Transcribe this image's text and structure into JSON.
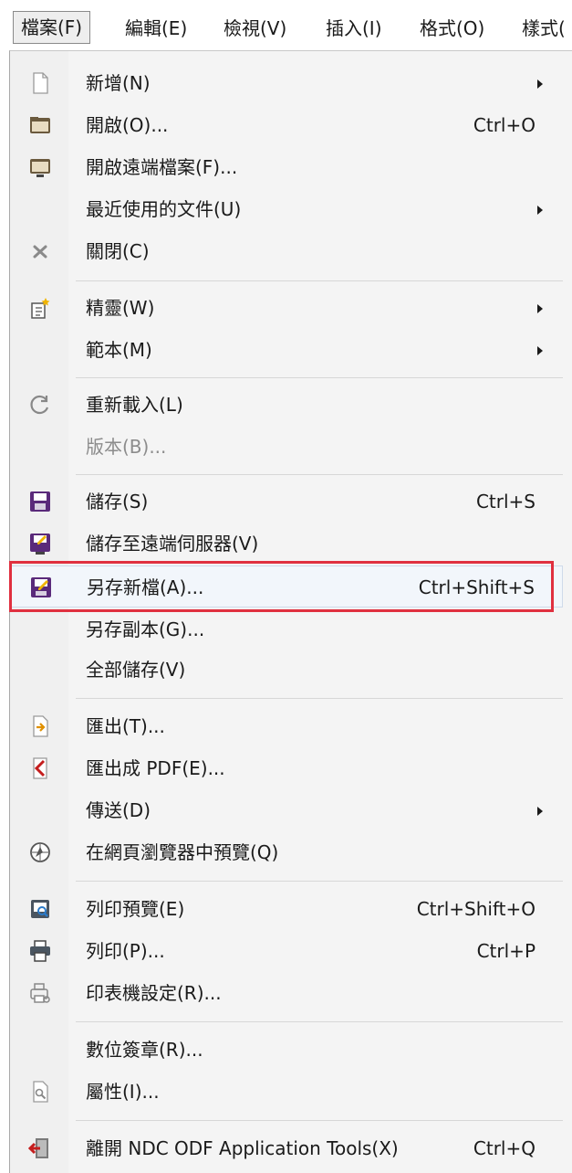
{
  "menubar": {
    "items": [
      {
        "label": "檔案(F)"
      },
      {
        "label": "編輯(E)"
      },
      {
        "label": "檢視(V)"
      },
      {
        "label": "插入(I)"
      },
      {
        "label": "格式(O)"
      },
      {
        "label": "樣式("
      }
    ]
  },
  "menu": {
    "items": [
      {
        "label": "新增(N)",
        "shortcut": "",
        "icon": "new-document-icon"
      },
      {
        "label": "開啟(O)...",
        "shortcut": "Ctrl+O",
        "icon": "open-folder-icon"
      },
      {
        "label": "開啟遠端檔案(F)...",
        "shortcut": "",
        "icon": "open-remote-icon"
      },
      {
        "label": "最近使用的文件(U)",
        "shortcut": "",
        "icon": ""
      },
      {
        "label": "關閉(C)",
        "shortcut": "",
        "icon": "close-icon"
      },
      {
        "label": "精靈(W)",
        "shortcut": "",
        "icon": "wizard-icon"
      },
      {
        "label": "範本(M)",
        "shortcut": "",
        "icon": ""
      },
      {
        "label": "重新載入(L)",
        "shortcut": "",
        "icon": "reload-icon"
      },
      {
        "label": "版本(B)...",
        "shortcut": "",
        "icon": ""
      },
      {
        "label": "儲存(S)",
        "shortcut": "Ctrl+S",
        "icon": "save-icon"
      },
      {
        "label": "儲存至遠端伺服器(V)",
        "shortcut": "",
        "icon": "save-remote-icon"
      },
      {
        "label": "另存新檔(A)...",
        "shortcut": "Ctrl+Shift+S",
        "icon": "save-as-icon"
      },
      {
        "label": "另存副本(G)...",
        "shortcut": "",
        "icon": ""
      },
      {
        "label": "全部儲存(V)",
        "shortcut": "",
        "icon": ""
      },
      {
        "label": "匯出(T)...",
        "shortcut": "",
        "icon": "export-icon"
      },
      {
        "label": "匯出成 PDF(E)...",
        "shortcut": "",
        "icon": "export-pdf-icon"
      },
      {
        "label": "傳送(D)",
        "shortcut": "",
        "icon": ""
      },
      {
        "label": "在網頁瀏覽器中預覽(Q)",
        "shortcut": "",
        "icon": "browser-preview-icon"
      },
      {
        "label": "列印預覽(E)",
        "shortcut": "Ctrl+Shift+O",
        "icon": "print-preview-icon"
      },
      {
        "label": "列印(P)...",
        "shortcut": "Ctrl+P",
        "icon": "printer-icon"
      },
      {
        "label": "印表機設定(R)...",
        "shortcut": "",
        "icon": "printer-settings-icon"
      },
      {
        "label": "數位簽章(R)...",
        "shortcut": "",
        "icon": ""
      },
      {
        "label": "屬性(I)...",
        "shortcut": "",
        "icon": "properties-icon"
      },
      {
        "label": "離開 NDC ODF Application Tools(X)",
        "shortcut": "Ctrl+Q",
        "icon": "exit-icon"
      }
    ]
  },
  "colors": {
    "highlight_border": "#e0303f",
    "icon_purple": "#5a2a7a",
    "icon_red": "#c41e1e"
  }
}
